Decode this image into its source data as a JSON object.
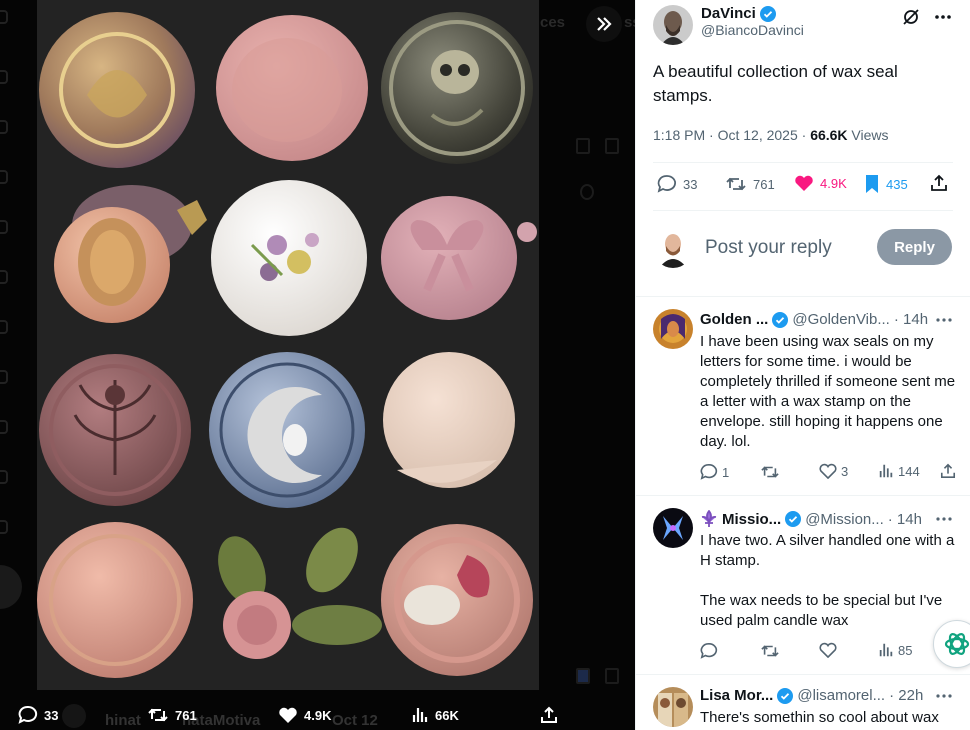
{
  "viewer": {
    "background_snippets": [
      "ces",
      "ss"
    ],
    "actions": {
      "replies": "33",
      "reposts": "761",
      "likes": "4.9K",
      "views": "66K"
    },
    "bottom_names": [
      "hinat",
      "nataMotiva",
      "Oct 12"
    ]
  },
  "colors": {
    "accent": "#1d9bf0",
    "like": "#f91880",
    "bookmark": "#1d9bf0",
    "text": "#0f1419",
    "muted": "#536471"
  },
  "post": {
    "author_name": "DaVinci",
    "author_handle": "@BiancoDavinci",
    "text": "A beautiful collection of wax seal stamps.",
    "time": "1:18 PM · Oct 12, 2025 · ",
    "views_count": "66.6K",
    "views_label": " Views",
    "stats": {
      "replies": "33",
      "reposts": "761",
      "likes": "4.9K",
      "bookmarks": "435"
    }
  },
  "compose": {
    "placeholder": "Post your reply",
    "button": "Reply"
  },
  "replies": [
    {
      "name": "Golden ...",
      "handle": "@GoldenVib...",
      "time": "· 14h",
      "text": "I have been using wax seals on my letters for some time.  i would be completely thrilled if someone sent me a letter with a wax stamp on the envelope. still hoping it happens one day. lol.",
      "replies": "1",
      "reposts": "",
      "likes": "3",
      "views": "144"
    },
    {
      "name": "Missio...",
      "handle": "@Mission...",
      "time": "· 14h",
      "text": "I have two.  A silver handled one with a H stamp.\n\nThe wax needs to be special but I've used palm candle wax",
      "replies": "",
      "reposts": "",
      "likes": "",
      "views": "85"
    },
    {
      "name": "Lisa Mor...",
      "handle": "@lisamorel...",
      "time": "· 22h",
      "text": "There's somethin so cool about wax"
    }
  ]
}
